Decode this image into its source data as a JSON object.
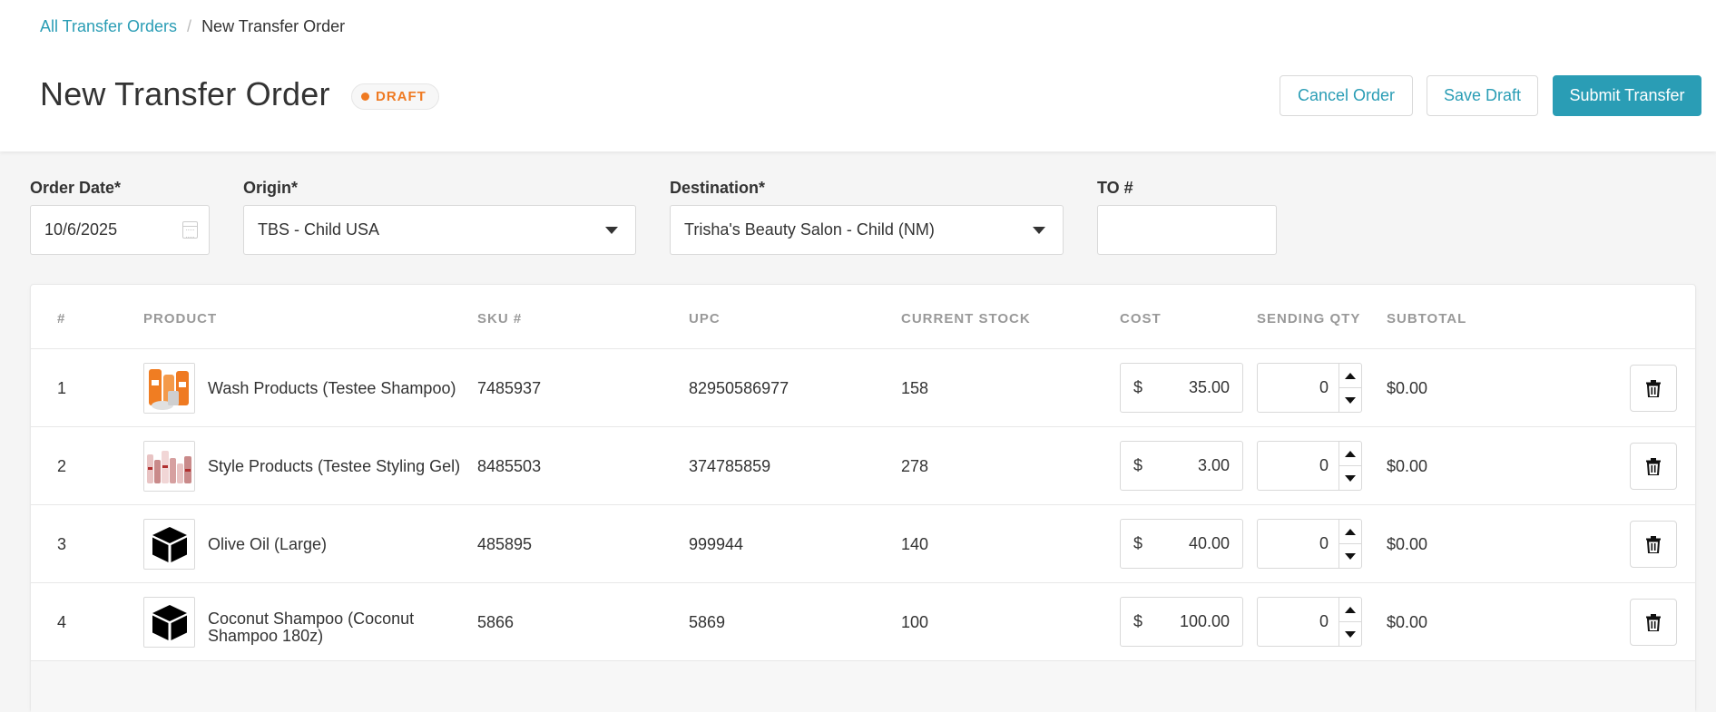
{
  "breadcrumb": {
    "parent": "All Transfer Orders",
    "separator": "/",
    "current": "New Transfer Order"
  },
  "page": {
    "title": "New Transfer Order",
    "status": "DRAFT"
  },
  "actions": {
    "cancel": "Cancel Order",
    "save_draft": "Save Draft",
    "submit": "Submit Transfer"
  },
  "form": {
    "order_date": {
      "label": "Order Date*",
      "value": "10/6/2025"
    },
    "origin": {
      "label": "Origin*",
      "value": "TBS - Child USA"
    },
    "destination": {
      "label": "Destination*",
      "value": "Trisha's Beauty Salon - Child (NM)"
    },
    "to_number": {
      "label": "TO #",
      "value": ""
    }
  },
  "table": {
    "headers": {
      "num": "#",
      "product": "PRODUCT",
      "sku": "SKU #",
      "upc": "UPC",
      "stock": "CURRENT STOCK",
      "cost": "COST",
      "qty": "SENDING QTY",
      "subtotal": "SUBTOTAL"
    },
    "currency_symbol": "$",
    "rows": [
      {
        "num": "1",
        "product": "Wash Products (Testee Shampoo)",
        "image": "shampoo-product-photo",
        "sku": "7485937",
        "upc": "82950586977",
        "stock": "158",
        "cost": "35.00",
        "qty": "0",
        "subtotal": "$0.00"
      },
      {
        "num": "2",
        "product": "Style Products (Testee Styling Gel)",
        "image": "styling-gel-product-photo",
        "sku": "8485503",
        "upc": "374785859",
        "stock": "278",
        "cost": "3.00",
        "qty": "0",
        "subtotal": "$0.00"
      },
      {
        "num": "3",
        "product": "Olive Oil (Large)",
        "image": "box-icon",
        "sku": "485895",
        "upc": "999944",
        "stock": "140",
        "cost": "40.00",
        "qty": "0",
        "subtotal": "$0.00"
      },
      {
        "num": "4",
        "product": "Coconut Shampoo (Coconut Shampoo 180z)",
        "image": "box-icon",
        "sku": "5866",
        "upc": "5869",
        "stock": "100",
        "cost": "100.00",
        "qty": "0",
        "subtotal": "$0.00"
      }
    ]
  },
  "colors": {
    "accent": "#2a9db5",
    "draft": "#ef7a22",
    "background": "#f5f5f5"
  }
}
